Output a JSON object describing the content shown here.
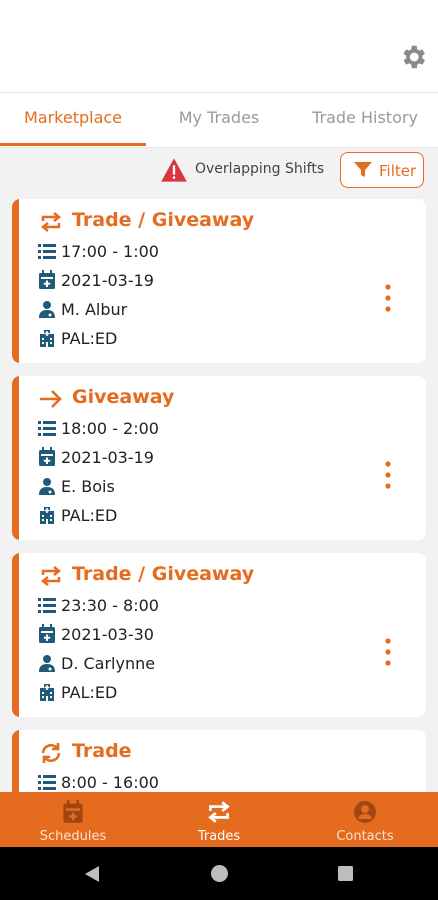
{
  "colors": {
    "accent": "#e56b1f",
    "warning": "#d9363e",
    "icon": "#1f5a78"
  },
  "header": {
    "settings_icon": "gear-icon"
  },
  "tabs": [
    {
      "label": "Marketplace",
      "active": true
    },
    {
      "label": "My Trades",
      "active": false
    },
    {
      "label": "Trade History",
      "active": false
    }
  ],
  "toolbar": {
    "warning_text": "Overlapping Shifts",
    "filter_label": "Filter"
  },
  "cards": [
    {
      "type": "Trade / Giveaway",
      "type_icon": "swap-icon",
      "time": "17:00 - 1:00",
      "date": "2021-03-19",
      "person": "M. Albur",
      "location": "PAL:ED"
    },
    {
      "type": "Giveaway",
      "type_icon": "arrow-right-icon",
      "time": "18:00 - 2:00",
      "date": "2021-03-19",
      "person": "E. Bois",
      "location": "PAL:ED"
    },
    {
      "type": "Trade / Giveaway",
      "type_icon": "swap-icon",
      "time": "23:30 - 8:00",
      "date": "2021-03-30",
      "person": "D. Carlynne",
      "location": "PAL:ED"
    },
    {
      "type": "Trade",
      "type_icon": "sync-icon",
      "time": "8:00 - 16:00"
    }
  ],
  "bottom_nav": [
    {
      "label": "Schedules",
      "icon": "calendar-icon",
      "active": false
    },
    {
      "label": "Trades",
      "icon": "swap-icon",
      "active": true
    },
    {
      "label": "Contacts",
      "icon": "person-icon",
      "active": false
    }
  ]
}
